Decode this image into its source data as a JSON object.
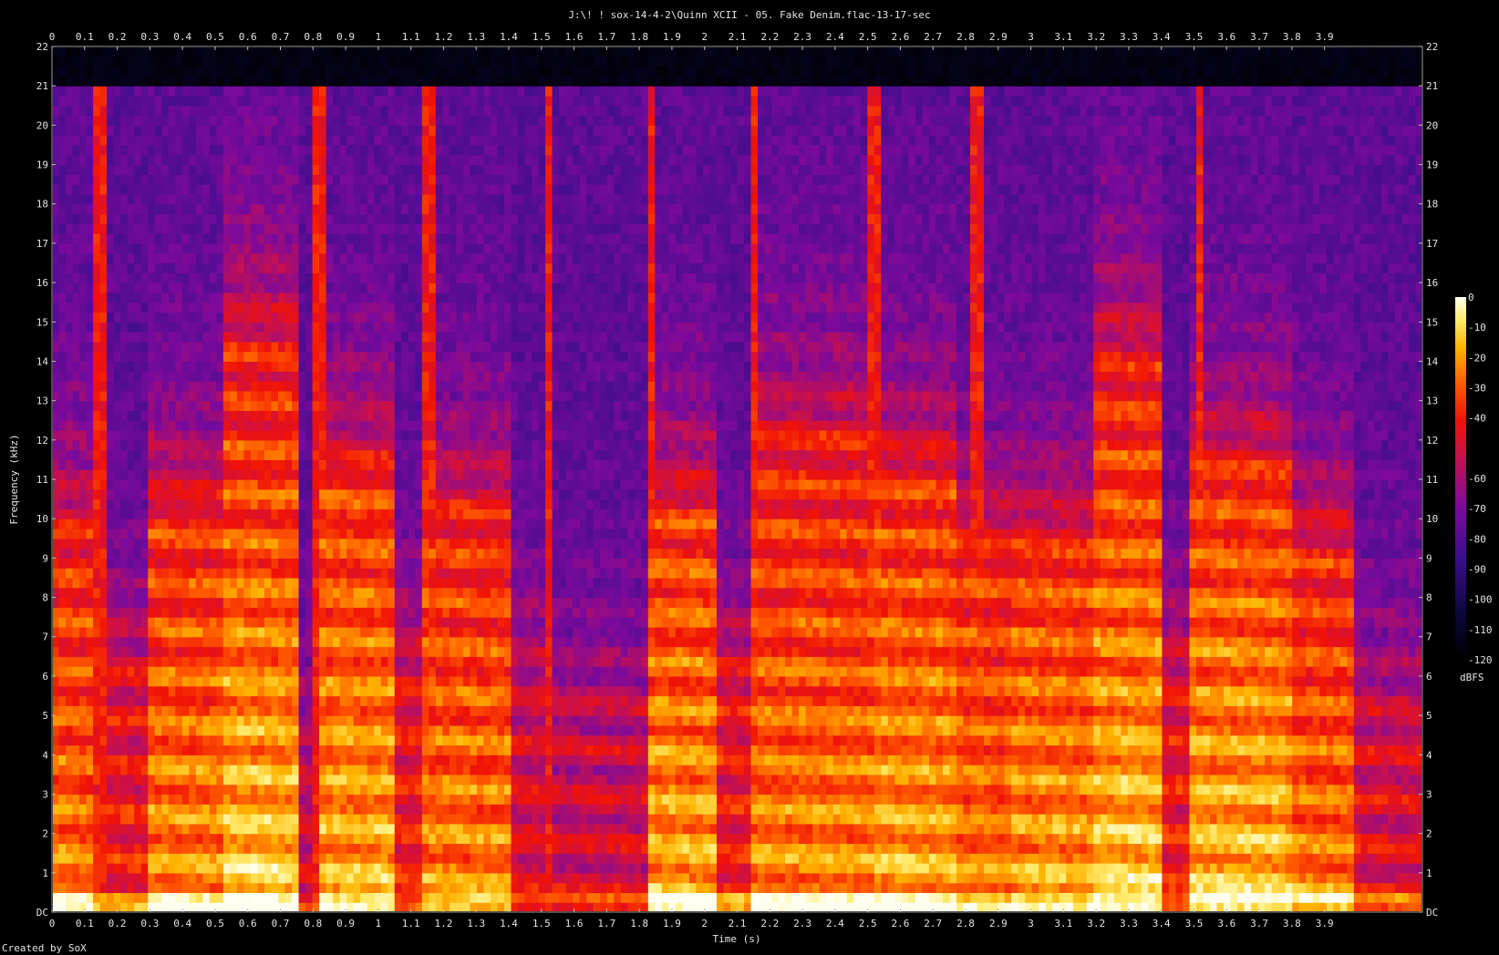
{
  "chart_data": {
    "type": "heatmap",
    "title": "J:\\! ! sox-14-4-2\\Quinn XCII - 05. Fake Denim.flac-13-17-sec",
    "xlabel": "Time (s)",
    "ylabel": "Frequency (kHz)",
    "x_range": [
      0,
      4.0
    ],
    "y_range": [
      0,
      22
    ],
    "x_ticks": [
      "0",
      "0.1",
      "0.2",
      "0.3",
      "0.4",
      "0.5",
      "0.6",
      "0.7",
      "0.8",
      "0.9",
      "1",
      "1.1",
      "1.2",
      "1.3",
      "1.4",
      "1.5",
      "1.6",
      "1.7",
      "1.8",
      "1.9",
      "2",
      "2.1",
      "2.2",
      "2.3",
      "2.4",
      "2.5",
      "2.6",
      "2.7",
      "2.8",
      "2.9",
      "3",
      "3.1",
      "3.2",
      "3.3",
      "3.4",
      "3.5",
      "3.6",
      "3.7",
      "3.8",
      "3.9"
    ],
    "y_ticks": [
      "DC",
      "1",
      "2",
      "3",
      "4",
      "5",
      "6",
      "7",
      "8",
      "9",
      "10",
      "11",
      "12",
      "13",
      "14",
      "15",
      "16",
      "17",
      "18",
      "19",
      "20",
      "21",
      "22"
    ],
    "colorbar": {
      "label": "dBFS",
      "range": [
        -120,
        0
      ],
      "ticks": [
        "0",
        "-10",
        "-20",
        "-30",
        "-40",
        "-60",
        "-70",
        "-80",
        "-90",
        "-100",
        "-110",
        "-120"
      ]
    },
    "cutoff_khz": 21,
    "segments": [
      {
        "t0": 0.0,
        "t1": 0.13,
        "intensity": 0.78,
        "upper_khz": 9.5
      },
      {
        "t0": 0.13,
        "t1": 0.28,
        "intensity": 0.55,
        "upper_khz": 6
      },
      {
        "t0": 0.28,
        "t1": 0.5,
        "intensity": 0.82,
        "upper_khz": 10
      },
      {
        "t0": 0.5,
        "t1": 0.72,
        "intensity": 0.95,
        "upper_khz": 14.3
      },
      {
        "t0": 0.72,
        "t1": 0.78,
        "intensity": 0.4,
        "upper_khz": 4
      },
      {
        "t0": 0.78,
        "t1": 1.0,
        "intensity": 0.9,
        "upper_khz": 11
      },
      {
        "t0": 1.0,
        "t1": 1.08,
        "intensity": 0.55,
        "upper_khz": 6
      },
      {
        "t0": 1.08,
        "t1": 1.35,
        "intensity": 0.8,
        "upper_khz": 10
      },
      {
        "t0": 1.35,
        "t1": 1.45,
        "intensity": 0.45,
        "upper_khz": 6
      },
      {
        "t0": 1.45,
        "t1": 1.75,
        "intensity": 0.4,
        "upper_khz": 5
      },
      {
        "t0": 1.75,
        "t1": 1.95,
        "intensity": 0.88,
        "upper_khz": 10
      },
      {
        "t0": 1.95,
        "t1": 2.05,
        "intensity": 0.55,
        "upper_khz": 6
      },
      {
        "t0": 2.05,
        "t1": 2.4,
        "intensity": 0.82,
        "upper_khz": 12
      },
      {
        "t0": 2.4,
        "t1": 2.65,
        "intensity": 0.88,
        "upper_khz": 11
      },
      {
        "t0": 2.65,
        "t1": 2.8,
        "intensity": 0.78,
        "upper_khz": 9
      },
      {
        "t0": 2.8,
        "t1": 3.05,
        "intensity": 0.85,
        "upper_khz": 9
      },
      {
        "t0": 3.05,
        "t1": 3.25,
        "intensity": 0.95,
        "upper_khz": 13.8
      },
      {
        "t0": 3.25,
        "t1": 3.33,
        "intensity": 0.55,
        "upper_khz": 6
      },
      {
        "t0": 3.33,
        "t1": 3.62,
        "intensity": 0.92,
        "upper_khz": 11
      },
      {
        "t0": 3.62,
        "t1": 3.8,
        "intensity": 0.78,
        "upper_khz": 9
      },
      {
        "t0": 3.8,
        "t1": 4.0,
        "intensity": 0.45,
        "upper_khz": 5
      }
    ],
    "transients": [
      0.14,
      0.78,
      1.1,
      1.45,
      1.75,
      2.05,
      2.4,
      2.7,
      3.35
    ]
  },
  "footer": {
    "credit": "Created by SoX"
  },
  "colors": {
    "background": "#000000",
    "text": "#e4e4e4"
  }
}
